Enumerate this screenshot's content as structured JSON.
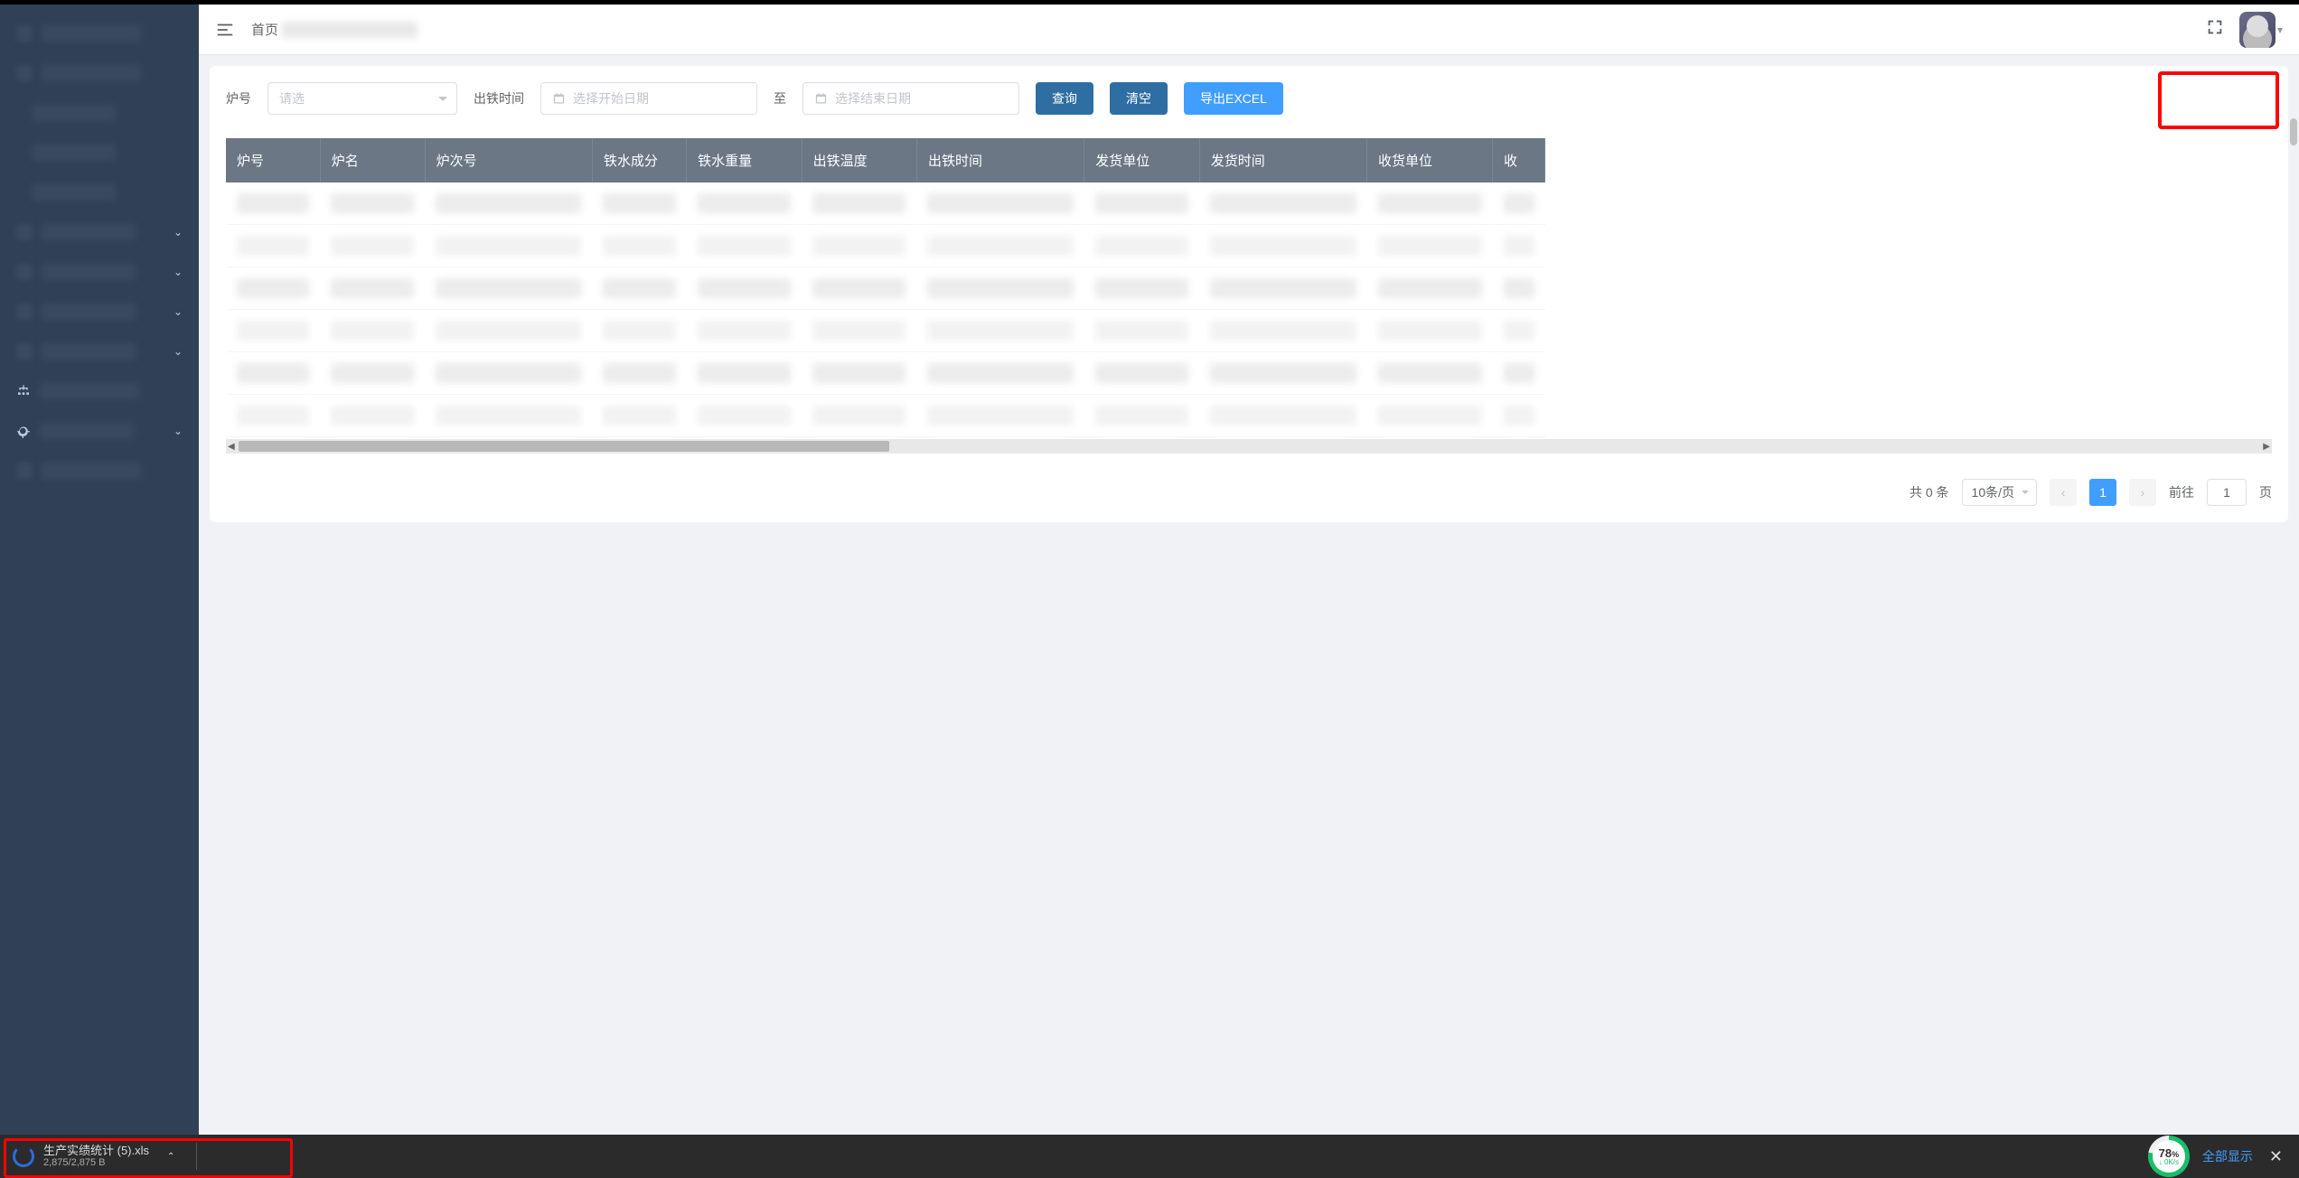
{
  "breadcrumb": {
    "home": "首页"
  },
  "filters": {
    "furnace_label": "炉号",
    "furnace_placeholder": "请选",
    "time_label": "出铁时间",
    "start_placeholder": "选择开始日期",
    "to": "至",
    "end_placeholder": "选择结束日期",
    "query": "查询",
    "clear": "清空",
    "export": "导出EXCEL"
  },
  "table": {
    "headers": [
      "炉号",
      "炉名",
      "炉次号",
      "铁水成分",
      "铁水重量",
      "出铁温度",
      "出铁时间",
      "发货单位",
      "发货时间",
      "收货单位",
      "收"
    ]
  },
  "pagination": {
    "total_text": "共 0 条",
    "page_size": "10条/页",
    "current": "1",
    "goto_prefix": "前往",
    "goto_value": "1",
    "goto_suffix": "页"
  },
  "download": {
    "filename": "生产实绩统计 (5).xls",
    "size": "2,875/2,875 B",
    "speed_pct": "78",
    "speed_unit": "%",
    "speed_rate": "0K/s",
    "show_all": "全部显示"
  }
}
